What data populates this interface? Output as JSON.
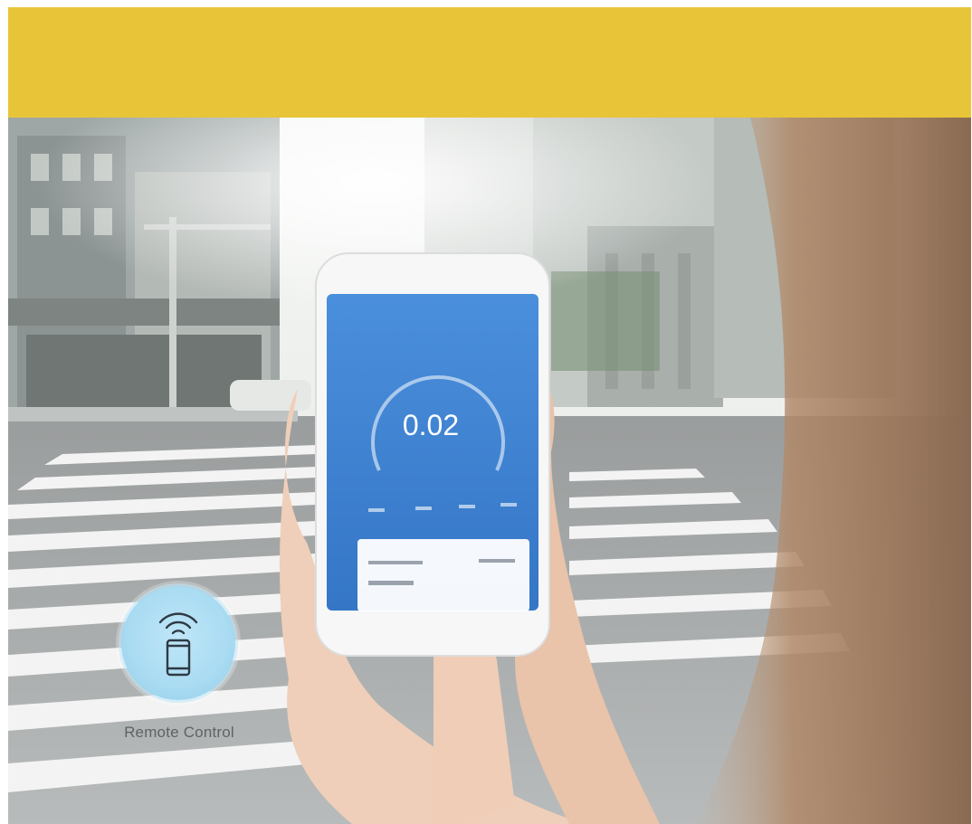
{
  "phone": {
    "reading": "0.02"
  },
  "feature": {
    "icon": "phone-wifi-icon",
    "label": "Remote Control"
  },
  "colors": {
    "banner": "#e8c438",
    "app_blue": "#3f86d6",
    "badge_blue": "#a9dbf2"
  }
}
